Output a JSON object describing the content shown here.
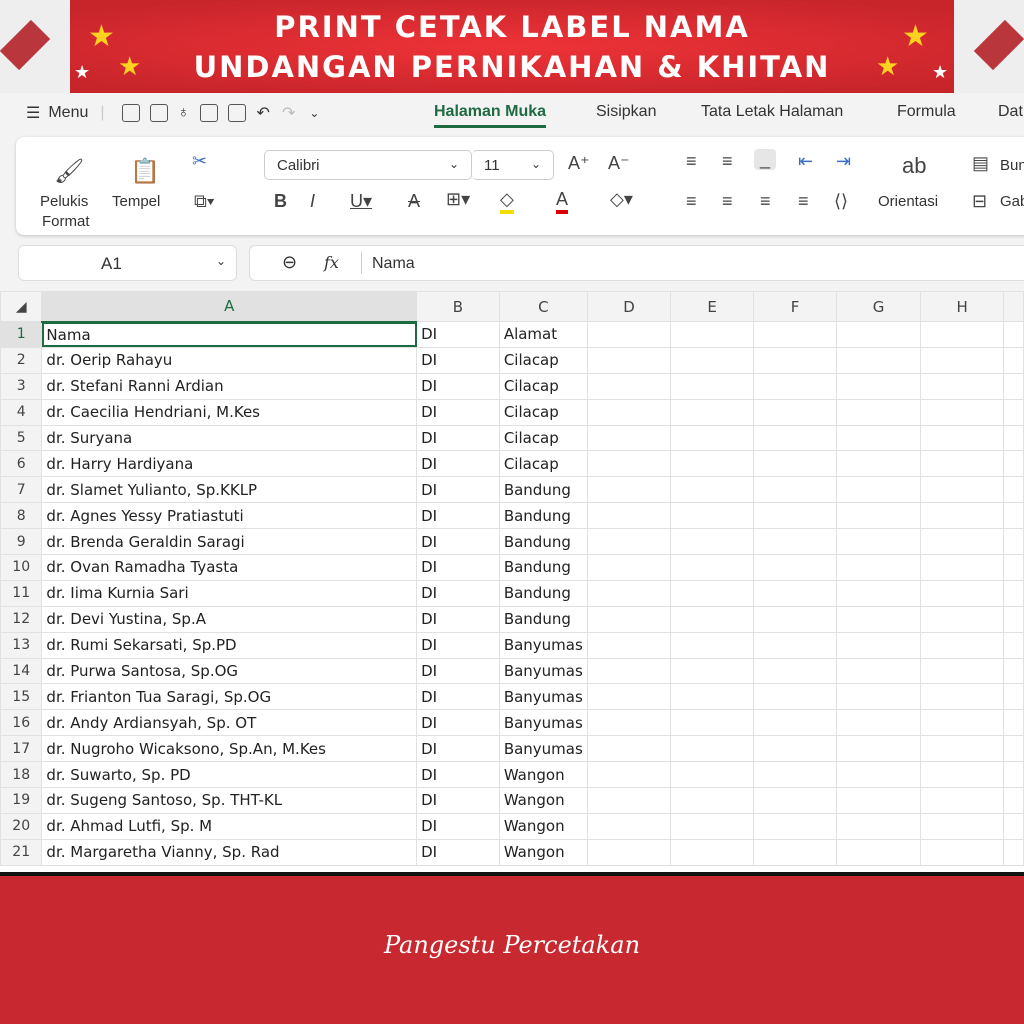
{
  "banner": {
    "line1": "PRINT CETAK LABEL NAMA",
    "line2": "UNDANGAN PERNIKAHAN & KHITAN"
  },
  "menubar": {
    "menu": "Menu",
    "tabs": [
      "Halaman Muka",
      "Sisipkan",
      "Tata Letak Halaman",
      "Formula",
      "Dat"
    ]
  },
  "ribbon": {
    "format_painter": "Pelukis",
    "format_painter2": "Format",
    "paste": "Tempel",
    "font": "Calibri",
    "size": "11",
    "orientation": "Orientasi",
    "wrap": "Bun",
    "merge": "Gab"
  },
  "formula": {
    "cell_ref": "A1",
    "fx": "fx",
    "value": "Nama"
  },
  "columns": [
    "A",
    "B",
    "C",
    "D",
    "E",
    "F",
    "G",
    "H"
  ],
  "rows": [
    [
      "Nama",
      "DI",
      "Alamat"
    ],
    [
      "dr. Oerip Rahayu",
      "DI",
      "Cilacap"
    ],
    [
      "dr. Stefani Ranni Ardian",
      "DI",
      "Cilacap"
    ],
    [
      "dr. Caecilia Hendriani, M.Kes",
      "DI",
      "Cilacap"
    ],
    [
      "dr. Suryana",
      "DI",
      "Cilacap"
    ],
    [
      "dr. Harry Hardiyana",
      "DI",
      "Cilacap"
    ],
    [
      "dr. Slamet Yulianto, Sp.KKLP",
      "DI",
      "Bandung"
    ],
    [
      "dr. Agnes Yessy Pratiastuti",
      "DI",
      "Bandung"
    ],
    [
      "dr. Brenda Geraldin Saragi",
      "DI",
      "Bandung"
    ],
    [
      "dr. Ovan Ramadha Tyasta",
      "DI",
      "Bandung"
    ],
    [
      "dr. Iima Kurnia Sari",
      "DI",
      "Bandung"
    ],
    [
      "dr. Devi Yustina, Sp.A",
      "DI",
      "Bandung"
    ],
    [
      "dr. Rumi Sekarsati, Sp.PD",
      "DI",
      "Banyumas"
    ],
    [
      "dr. Purwa Santosa, Sp.OG",
      "DI",
      "Banyumas"
    ],
    [
      "dr. Frianton Tua Saragi, Sp.OG",
      "DI",
      "Banyumas"
    ],
    [
      "dr. Andy Ardiansyah, Sp. OT",
      "DI",
      "Banyumas"
    ],
    [
      "dr. Nugroho Wicaksono, Sp.An, M.Kes",
      "DI",
      "Banyumas"
    ],
    [
      "dr. Suwarto, Sp. PD",
      "DI",
      "Wangon"
    ],
    [
      "dr. Sugeng Santoso, Sp. THT-KL",
      "DI",
      "Wangon"
    ],
    [
      "dr. Ahmad Lutfi, Sp. M",
      "DI",
      "Wangon"
    ],
    [
      "dr. Margaretha Vianny, Sp. Rad",
      "DI",
      "Wangon"
    ]
  ],
  "footer": {
    "brand": "Pangestu Percetakan"
  }
}
